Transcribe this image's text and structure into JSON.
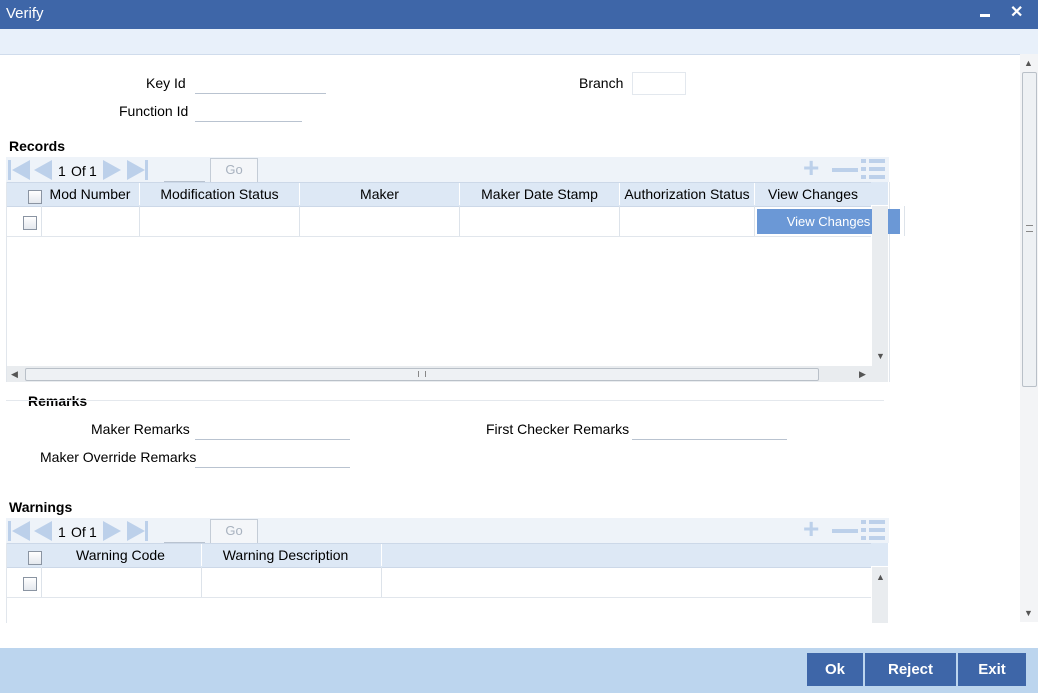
{
  "window": {
    "title": "Verify",
    "minimize_glyph": "▬",
    "close_glyph": "✕"
  },
  "form": {
    "key_id_label": "Key Id",
    "key_id_value": "",
    "branch_label": "Branch",
    "branch_value": "",
    "function_id_label": "Function Id",
    "function_id_value": ""
  },
  "records": {
    "section_title": "Records",
    "pager": {
      "current": "1",
      "of_label": "Of",
      "total": "1",
      "go_label": "Go"
    },
    "columns": [
      "Mod Number",
      "Modification Status",
      "Maker",
      "Maker Date Stamp",
      "Authorization Status",
      "View Changes"
    ],
    "row_button_label": "View Changes",
    "rows": [
      {
        "mod_number": "",
        "modification_status": "",
        "maker": "",
        "maker_date_stamp": "",
        "authorization_status": ""
      }
    ]
  },
  "remarks": {
    "section_title": "Remarks",
    "maker_remarks_label": "Maker Remarks",
    "maker_remarks_value": "",
    "first_checker_label": "First Checker Remarks",
    "first_checker_value": "",
    "maker_override_label": "Maker Override Remarks",
    "maker_override_value": ""
  },
  "warnings": {
    "section_title": "Warnings",
    "pager": {
      "current": "1",
      "of_label": "Of",
      "total": "1",
      "go_label": "Go"
    },
    "columns": [
      "Warning Code",
      "Warning Description"
    ]
  },
  "footer": {
    "ok_label": "Ok",
    "reject_label": "Reject",
    "exit_label": "Exit"
  },
  "icons": [
    "first-page-icon",
    "prev-page-icon",
    "next-page-icon",
    "last-page-icon",
    "add-row-icon",
    "delete-row-icon",
    "single-view-icon",
    "close-icon",
    "minimize-icon"
  ],
  "colors": {
    "title_bar": "#3e66a8",
    "footer": "#bcd5ee",
    "header_row": "#dde8f5",
    "view_changes_button": "#6b98d6"
  }
}
